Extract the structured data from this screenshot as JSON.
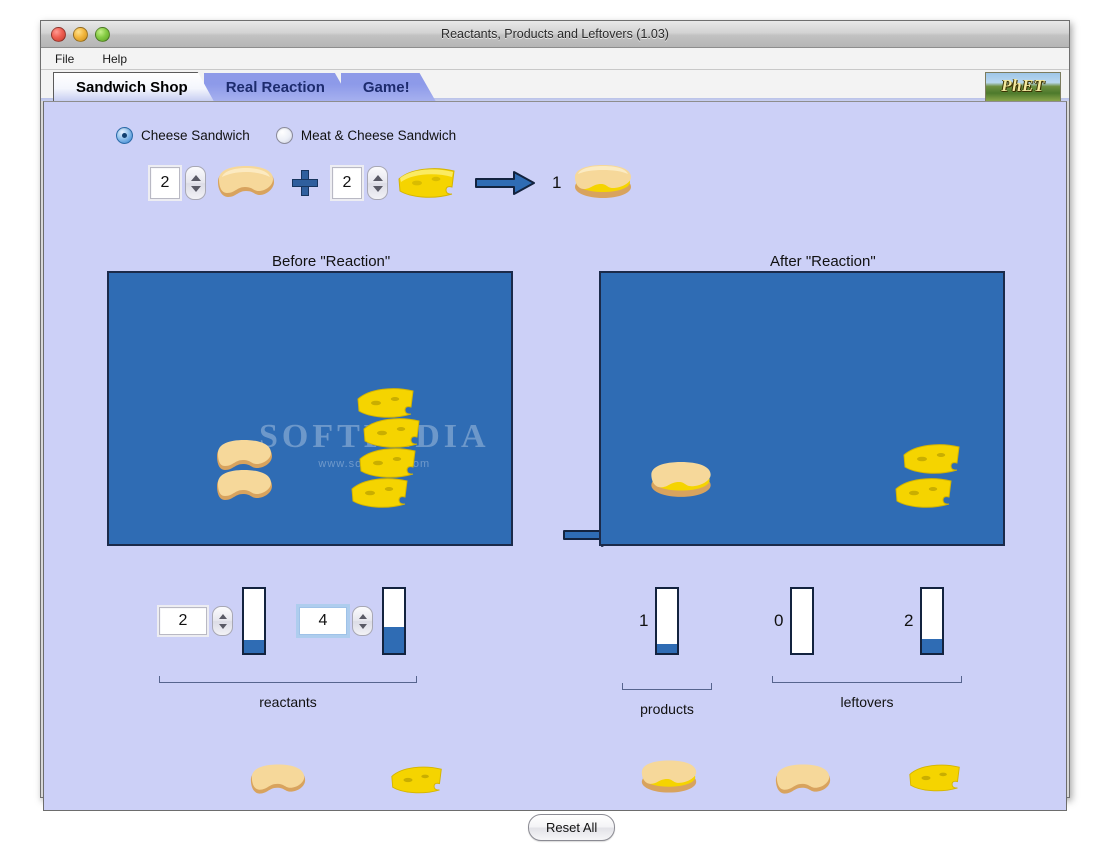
{
  "window": {
    "title": "Reactants, Products and Leftovers (1.03)",
    "traffic_lights": [
      "close",
      "minimize",
      "zoom"
    ]
  },
  "menubar": {
    "items": [
      "File",
      "Help"
    ]
  },
  "tabs": [
    {
      "label": "Sandwich Shop",
      "active": true
    },
    {
      "label": "Real Reaction",
      "active": false
    },
    {
      "label": "Game!",
      "active": false
    }
  ],
  "logo": {
    "text": "PhET"
  },
  "sandwich_options": [
    {
      "label": "Cheese Sandwich",
      "selected": true
    },
    {
      "label": "Meat & Cheese Sandwich",
      "selected": false
    }
  ],
  "equation": {
    "bread_coefficient": "2",
    "cheese_coefficient": "2",
    "product_coefficient": "1",
    "plus": "+",
    "arrow": "right-arrow"
  },
  "panels": {
    "before_title": "Before \"Reaction\"",
    "after_title": "After \"Reaction\""
  },
  "watermark": {
    "text": "SOFTPEDIA",
    "sub": "www.softpedia.com"
  },
  "before_contents": {
    "bread_count": 2,
    "cheese_count": 4
  },
  "after_contents": {
    "sandwich_count": 1,
    "bread_count": 0,
    "cheese_count": 2
  },
  "reactants": {
    "bracket_label": "reactants",
    "items": [
      {
        "name": "bread",
        "value": "2",
        "fill_percent": 20,
        "focused": false
      },
      {
        "name": "cheese",
        "value": "4",
        "fill_percent": 40,
        "focused": true
      }
    ]
  },
  "products": {
    "bracket_label": "products",
    "items": [
      {
        "name": "cheese-sandwich",
        "value": "1",
        "fill_percent": 14
      }
    ]
  },
  "leftovers": {
    "bracket_label": "leftovers",
    "items": [
      {
        "name": "bread",
        "value": "0",
        "fill_percent": 0
      },
      {
        "name": "cheese",
        "value": "2",
        "fill_percent": 22
      }
    ]
  },
  "reset": {
    "label": "Reset All"
  },
  "colors": {
    "panel_background": "#ccd0f7",
    "reaction_box": "#2f6cb4",
    "arrow_blue": "#2f6cb4",
    "active_tab_text": "#000000",
    "inactive_tab": "#8e9ae8",
    "inactive_tab_text": "#1d2b6e"
  }
}
